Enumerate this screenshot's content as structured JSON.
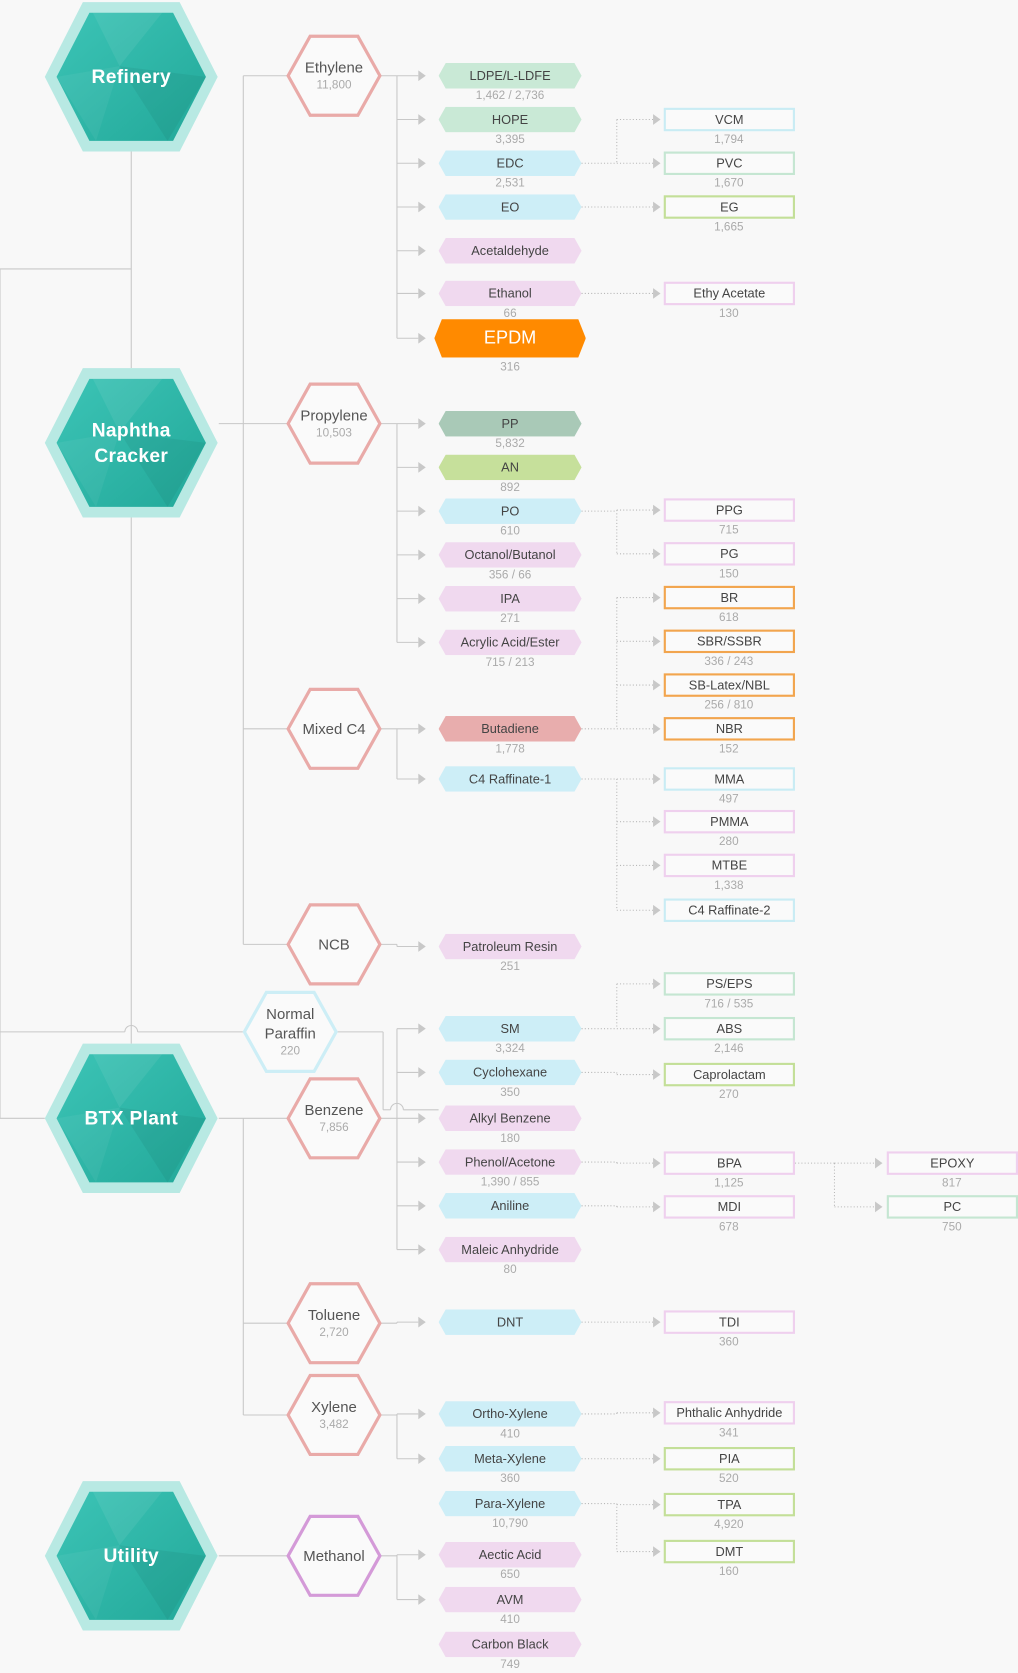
{
  "colors": {
    "source_outer": "#b8e9e3",
    "source_inner": "#2cb4a7",
    "feedstock_border": "#e9aaa8",
    "paraffin_border": "#cdeef6",
    "methanol_border": "#d49ad8",
    "connector": "#c8c8c8"
  },
  "sources": [
    {
      "label": "Refinery"
    },
    {
      "label": "Naphtha\nCracker"
    },
    {
      "label": "BTX Plant"
    },
    {
      "label": "Utility"
    }
  ],
  "feedstocks": [
    {
      "label": "Ethylene",
      "value": "11,800",
      "border": "#e9aaa8"
    },
    {
      "label": "Propylene",
      "value": "10,503",
      "border": "#e9aaa8"
    },
    {
      "label": "Mixed C4",
      "value": "",
      "border": "#e9aaa8"
    },
    {
      "label": "NCB",
      "value": "",
      "border": "#e9aaa8"
    },
    {
      "label": "Normal\nParaffin",
      "value": "220",
      "border": "#cdeef6"
    },
    {
      "label": "Benzene",
      "value": "7,856",
      "border": "#e9aaa8"
    },
    {
      "label": "Toluene",
      "value": "2,720",
      "border": "#e9aaa8"
    },
    {
      "label": "Xylene",
      "value": "3,482",
      "border": "#e9aaa8"
    },
    {
      "label": "Methanol",
      "value": "",
      "border": "#d49ad8"
    }
  ],
  "products": [
    {
      "label": "LDPE/L-LDFE",
      "value": "1,462 / 2,736",
      "color": "#c9e9d6"
    },
    {
      "label": "HOPE",
      "value": "3,395",
      "color": "#c9e9d6"
    },
    {
      "label": "EDC",
      "value": "2,531",
      "color": "#cdeef7"
    },
    {
      "label": "EO",
      "value": "",
      "color": "#cdeef7"
    },
    {
      "label": "Acetaldehyde",
      "value": "",
      "color": "#f0d9ef"
    },
    {
      "label": "Ethanol",
      "value": "66",
      "color": "#f0d9ef"
    },
    {
      "label": "EPDM",
      "value": "316",
      "color": "#ff8a00",
      "highlight": true
    },
    {
      "label": "PP",
      "value": "5,832",
      "color": "#a9c9b7"
    },
    {
      "label": "AN",
      "value": "892",
      "color": "#c6e09b"
    },
    {
      "label": "PO",
      "value": "610",
      "color": "#cdeef7"
    },
    {
      "label": "Octanol/Butanol",
      "value": "356 / 66",
      "color": "#f0d9ef"
    },
    {
      "label": "IPA",
      "value": "271",
      "color": "#f0d9ef"
    },
    {
      "label": "Acrylic Acid/Ester",
      "value": "715 / 213",
      "color": "#f0d9ef"
    },
    {
      "label": "Butadiene",
      "value": "1,778",
      "color": "#e8adad"
    },
    {
      "label": "C4 Raffinate-1",
      "value": "",
      "color": "#cdeef7"
    },
    {
      "label": "Patroleum Resin",
      "value": "251",
      "color": "#f0d9ef"
    },
    {
      "label": "SM",
      "value": "3,324",
      "color": "#cdeef7"
    },
    {
      "label": "Cyclohexane",
      "value": "350",
      "color": "#cdeef7"
    },
    {
      "label": "Alkyl Benzene",
      "value": "180",
      "color": "#f0d9ef"
    },
    {
      "label": "Phenol/Acetone",
      "value": "1,390 / 855",
      "color": "#f0d9ef"
    },
    {
      "label": "Aniline",
      "value": "",
      "color": "#cdeef7"
    },
    {
      "label": "Maleic Anhydride",
      "value": "80",
      "color": "#f0d9ef"
    },
    {
      "label": "DNT",
      "value": "",
      "color": "#cdeef7"
    },
    {
      "label": "Ortho-Xylene",
      "value": "410",
      "color": "#cdeef7"
    },
    {
      "label": "Meta-Xylene",
      "value": "360",
      "color": "#cdeef7"
    },
    {
      "label": "Para-Xylene",
      "value": "10,790",
      "color": "#cdeef7"
    },
    {
      "label": "Aectic Acid",
      "value": "650",
      "color": "#f0d9ef"
    },
    {
      "label": "AVM",
      "value": "410",
      "color": "#f0d9ef"
    },
    {
      "label": "Carbon Black",
      "value": "749",
      "color": "#f0d9ef"
    }
  ],
  "derivatives": [
    {
      "label": "VCM",
      "value": "1,794",
      "border": "#c9ecf4"
    },
    {
      "label": "PVC",
      "value": "1,670",
      "border": "#c5e6d2"
    },
    {
      "label": "EG",
      "value": "1,665",
      "border": "#c3df98"
    },
    {
      "label": "Ethy Acetate",
      "value": "130",
      "border": "#efd0ee"
    },
    {
      "label": "PPG",
      "value": "715",
      "border": "#efd0ee"
    },
    {
      "label": "PG",
      "value": "150",
      "border": "#efd0ee"
    },
    {
      "label": "BR",
      "value": "618",
      "border": "#f2a54e"
    },
    {
      "label": "SBR/SSBR",
      "value": "336 / 243",
      "border": "#f2a54e"
    },
    {
      "label": "SB-Latex/NBL",
      "value": "256 / 810",
      "border": "#f2a54e"
    },
    {
      "label": "NBR",
      "value": "152",
      "border": "#f2a54e"
    },
    {
      "label": "MMA",
      "value": "497",
      "border": "#c9ecf4"
    },
    {
      "label": "PMMA",
      "value": "280",
      "border": "#efd0ee"
    },
    {
      "label": "MTBE",
      "value": "1,338",
      "border": "#efd0ee"
    },
    {
      "label": "C4 Raffinate-2",
      "value": "",
      "border": "#c9ecf4"
    },
    {
      "label": "PS/EPS",
      "value": "716 / 535",
      "border": "#c5e6d2"
    },
    {
      "label": "ABS",
      "value": "2,146",
      "border": "#c5e6d2"
    },
    {
      "label": "Caprolactam",
      "value": "270",
      "border": "#c3df98"
    },
    {
      "label": "BPA",
      "value": "1,125",
      "border": "#efd0ee"
    },
    {
      "label": "MDI",
      "value": "678",
      "border": "#efd0ee"
    },
    {
      "label": "TDI",
      "value": "360",
      "border": "#efd0ee"
    },
    {
      "label": "Phthalic Anhydride",
      "value": "341",
      "border": "#efd0ee"
    },
    {
      "label": "PIA",
      "value": "520",
      "border": "#c3df98"
    },
    {
      "label": "TPA",
      "value": "4,920",
      "border": "#c3df98"
    },
    {
      "label": "DMT",
      "value": "160",
      "border": "#c3df98"
    }
  ],
  "downstream": [
    {
      "label": "EPOXY",
      "value": "817",
      "border": "#efd0ee"
    },
    {
      "label": "PC",
      "value": "750",
      "border": "#c5e6d2"
    }
  ]
}
